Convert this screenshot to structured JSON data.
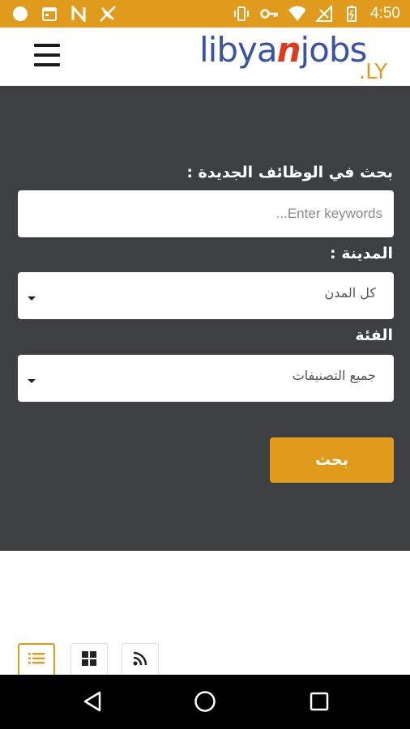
{
  "status_bar": {
    "time": "4:50",
    "left_icons": [
      "circle-icon",
      "calendar-icon",
      "n-icon",
      "signal-off-icon"
    ],
    "right_icons": [
      "vibrate-icon",
      "key-icon",
      "wifi-icon",
      "cell-signal-icon",
      "battery-icon"
    ]
  },
  "header": {
    "logo_text_1": "libya",
    "logo_text_accent": "n",
    "logo_text_2": "jobs",
    "logo_suffix": ".LY"
  },
  "search": {
    "heading": "بحث في الوظائف الجديدة :",
    "keywords_placeholder": "...Enter keywords",
    "city_label": "المدينة :",
    "city_selected": "كل المدن",
    "category_label": "الفئة",
    "category_selected": "جميع التصنيفات",
    "submit_label": "بحث"
  },
  "view_toggles": [
    "list-view-icon",
    "grid-view-icon",
    "rss-icon"
  ],
  "nav_bar": [
    "back-icon",
    "home-icon",
    "recents-icon"
  ],
  "colors": {
    "accent": "#E09A1C",
    "panel": "#3D3F41",
    "logo_blue": "#3A53A4",
    "logo_red": "#E03A1E"
  }
}
